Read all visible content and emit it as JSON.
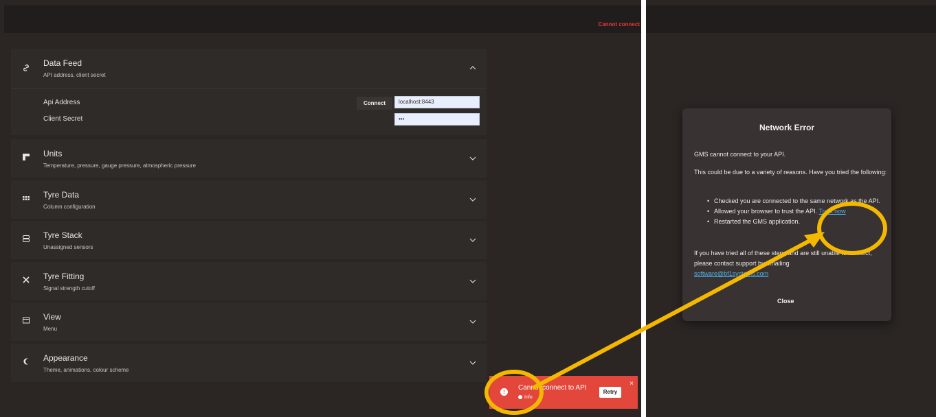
{
  "header": {
    "status_text": "Cannot connect"
  },
  "panels": [
    {
      "title": "Data Feed",
      "subtitle": "API address, client secret",
      "icon": "link-icon",
      "expanded": true
    },
    {
      "title": "Units",
      "subtitle": "Temperature, pressure, gauge pressure, atmospheric pressure",
      "icon": "ruler-corner-icon"
    },
    {
      "title": "Tyre Data",
      "subtitle": "Column configuration",
      "icon": "grid-icon"
    },
    {
      "title": "Tyre Stack",
      "subtitle": "Unassigned sensors",
      "icon": "stack-icon"
    },
    {
      "title": "Tyre Fitting",
      "subtitle": "Signal strength cutoff",
      "icon": "tools-icon"
    },
    {
      "title": "View",
      "subtitle": "Menu",
      "icon": "window-icon"
    },
    {
      "title": "Appearance",
      "subtitle": "Theme, animations, colour scheme",
      "icon": "moon-icon"
    }
  ],
  "data_feed": {
    "api_address_label": "Api Address",
    "client_secret_label": "Client Secret",
    "connect_label": "Connect",
    "api_address_value": "localhost:8443",
    "client_secret_value": "•••"
  },
  "toast": {
    "message": "Cannot connect to API",
    "info": "Info",
    "retry_label": "Retry",
    "close": "×"
  },
  "modal": {
    "title": "Network Error",
    "p1": "GMS cannot connect to your API.",
    "p2": "This could be due to a variety of reasons. Have you tried the following:",
    "bullet1": "Checked you are connected to the same network as the API.",
    "bullet2": "Allowed your browser to trust the API.",
    "bullet2_link": "Trust now",
    "bullet3": "Restarted the GMS application.",
    "p3": "If you have tried all of these steps and are still unable to connect, please contact support by emailing",
    "email": "software@bf1systems.com",
    "close_label": "Close"
  },
  "colors": {
    "accent_annotation": "#f5b800",
    "error": "#e3473b",
    "link": "#4fb3e8"
  }
}
